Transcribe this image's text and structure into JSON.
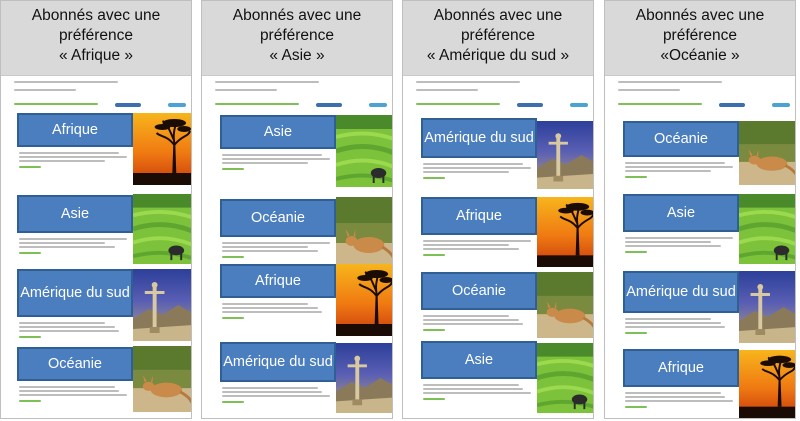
{
  "panels": [
    {
      "title": [
        "Abonnés avec une",
        "préférence",
        "« Afrique »"
      ],
      "articles": [
        {
          "label": "Afrique",
          "photo": "africa-sunset-photo"
        },
        {
          "label": "Asie",
          "photo": "asia-rice-terraces-photo"
        },
        {
          "label": "Amérique du sud",
          "photo": "south-america-statue-photo"
        },
        {
          "label": "Océanie",
          "photo": "oceania-kangaroo-photo"
        }
      ]
    },
    {
      "title": [
        "Abonnés avec une",
        "préférence",
        "« Asie »"
      ],
      "articles": [
        {
          "label": "Asie",
          "photo": "asia-rice-terraces-photo"
        },
        {
          "label": "Océanie",
          "photo": "oceania-kangaroo-photo"
        },
        {
          "label": "Afrique",
          "photo": "africa-sunset-photo"
        },
        {
          "label": "Amérique du sud",
          "photo": "south-america-statue-photo"
        }
      ]
    },
    {
      "title": [
        "Abonnés avec une",
        "préférence",
        "« Amérique du sud »"
      ],
      "articles": [
        {
          "label": "Amérique du sud",
          "photo": "south-america-statue-photo"
        },
        {
          "label": "Afrique",
          "photo": "africa-sunset-photo"
        },
        {
          "label": "Océanie",
          "photo": "oceania-kangaroo-photo"
        },
        {
          "label": "Asie",
          "photo": "asia-rice-terraces-photo"
        }
      ]
    },
    {
      "title": [
        "Abonnés avec une",
        "préférence",
        "«Océanie »"
      ],
      "articles": [
        {
          "label": "Océanie",
          "photo": "oceania-kangaroo-photo"
        },
        {
          "label": "Asie",
          "photo": "asia-rice-terraces-photo"
        },
        {
          "label": "Amérique du sud",
          "photo": "south-america-statue-photo"
        },
        {
          "label": "Afrique",
          "photo": "africa-sunset-photo"
        }
      ]
    }
  ],
  "colors": {
    "label_fill": "#4a7ebf",
    "label_border": "#2f5f93",
    "header_fill": "#d9d9d9"
  }
}
